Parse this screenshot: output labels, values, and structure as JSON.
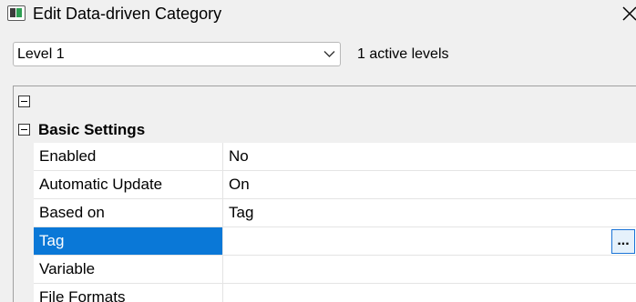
{
  "window": {
    "title": "Edit Data-driven Category",
    "icon": "app-window-icon",
    "close_icon": "close-icon"
  },
  "level_select": {
    "value": "Level 1",
    "icon": "chevron-down-icon"
  },
  "active_levels_text": "1 active levels",
  "property_grid": {
    "category": {
      "label": "Basic Settings",
      "expanded": true
    },
    "rows": [
      {
        "name": "Enabled",
        "value": "No"
      },
      {
        "name": "Automatic Update",
        "value": "On"
      },
      {
        "name": "Based on",
        "value": "Tag"
      },
      {
        "name": "Tag",
        "value": "",
        "selected": true,
        "button_label": "..."
      },
      {
        "name": "Variable",
        "value": ""
      },
      {
        "name": "File Formats",
        "value": ""
      }
    ]
  },
  "colors": {
    "selection": "#0a78d7",
    "ellipsis_button_bg": "#e5f1fb",
    "ellipsis_button_border": "#1a73d6"
  }
}
